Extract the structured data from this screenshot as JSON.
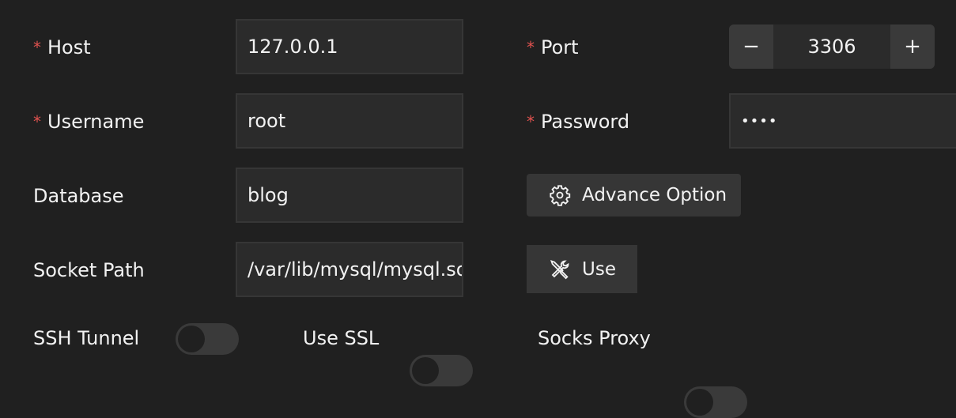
{
  "fields": {
    "host": {
      "label": "Host",
      "required": true,
      "value": "127.0.0.1"
    },
    "port": {
      "label": "Port",
      "required": true,
      "value": "3306",
      "decrement": "−",
      "increment": "+"
    },
    "username": {
      "label": "Username",
      "required": true,
      "value": "root"
    },
    "password": {
      "label": "Password",
      "required": true,
      "value": "••••"
    },
    "database": {
      "label": "Database",
      "value": "blog"
    },
    "socket_path": {
      "label": "Socket Path",
      "value": "/var/lib/mysql/mysql.sock"
    }
  },
  "required_marker": "*",
  "buttons": {
    "advance_option": {
      "label": "Advance Option",
      "icon": "gear-icon"
    },
    "use": {
      "label": "Use",
      "icon": "tools-icon"
    }
  },
  "toggles": [
    {
      "label": "SSH Tunnel",
      "on": false
    },
    {
      "label": "Use SSL",
      "on": false
    },
    {
      "label": "Socks Proxy",
      "on": false
    }
  ],
  "colors": {
    "background": "#202020",
    "input": "#2b2b2b",
    "button": "#363636",
    "required": "#e0524f"
  }
}
